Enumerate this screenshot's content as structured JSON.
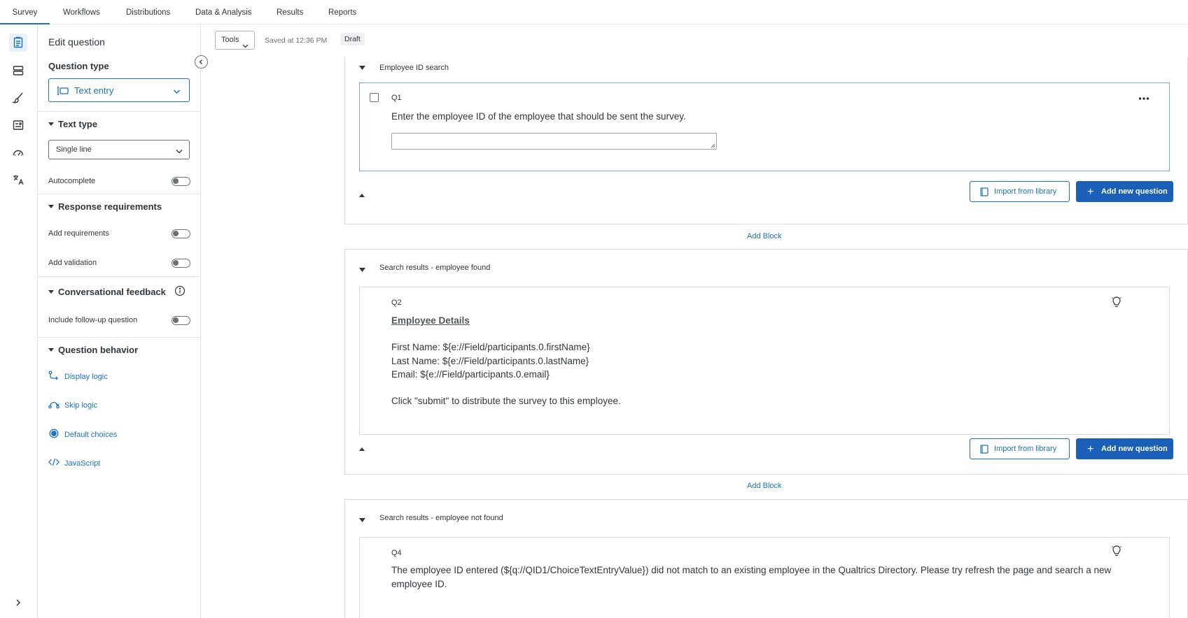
{
  "nav": {
    "tabs": [
      {
        "label": "Survey",
        "active": true
      },
      {
        "label": "Workflows"
      },
      {
        "label": "Distributions"
      },
      {
        "label": "Data & Analysis"
      },
      {
        "label": "Results"
      },
      {
        "label": "Reports"
      }
    ]
  },
  "rail": {
    "icons": [
      "survey-icon",
      "blocks-icon",
      "look-and-feel-icon",
      "survey-flow-icon",
      "survey-options-icon",
      "translate-icon"
    ],
    "expand_icon": "chevron-right-icon"
  },
  "panel": {
    "title": "Edit question",
    "question_type_heading": "Question type",
    "question_type_value": "Text entry",
    "text_type_heading": "Text type",
    "text_type_value": "Single line",
    "autocomplete_label": "Autocomplete",
    "response_req_heading": "Response requirements",
    "add_requirements_label": "Add requirements",
    "add_validation_label": "Add validation",
    "conv_feedback_heading": "Conversational feedback",
    "follow_up_label": "Include follow-up question",
    "behavior_heading": "Question behavior",
    "behavior_links": [
      "Display logic",
      "Skip logic",
      "Default choices",
      "JavaScript"
    ]
  },
  "toolbar": {
    "tools_label": "Tools",
    "saved_text": "Saved at 12:36 PM",
    "status_badge": "Draft"
  },
  "blocks": [
    {
      "title": "Employee ID search",
      "question": {
        "number": "Q1",
        "text": "Enter the employee ID of the employee that should be sent the survey."
      },
      "import_label": "Import from library",
      "add_label": "Add new question"
    },
    {
      "title": "Search results - employee found",
      "question": {
        "number": "Q2",
        "heading": "Employee Details",
        "lines": [
          "First Name: ${e://Field/participants.0.firstName}",
          "Last Name: ${e://Field/participants.0.lastName}",
          "Email: ${e://Field/participants.0.email}"
        ],
        "footer": "Click \"submit\" to distribute the survey to this employee."
      },
      "import_label": "Import from library",
      "add_label": "Add new question"
    },
    {
      "title": "Search results - employee not found",
      "question": {
        "number": "Q4",
        "text": "The employee ID entered (${q://QID1/ChoiceTextEntryValue}) did not match to an existing employee in the Qualtrics Directory. Please try refresh the page and search a new employee ID."
      }
    }
  ],
  "add_block_label": "Add Block",
  "colors": {
    "accent": "#1a73c4",
    "primary_button": "#1a5fb8",
    "border": "#d9dcdf"
  }
}
